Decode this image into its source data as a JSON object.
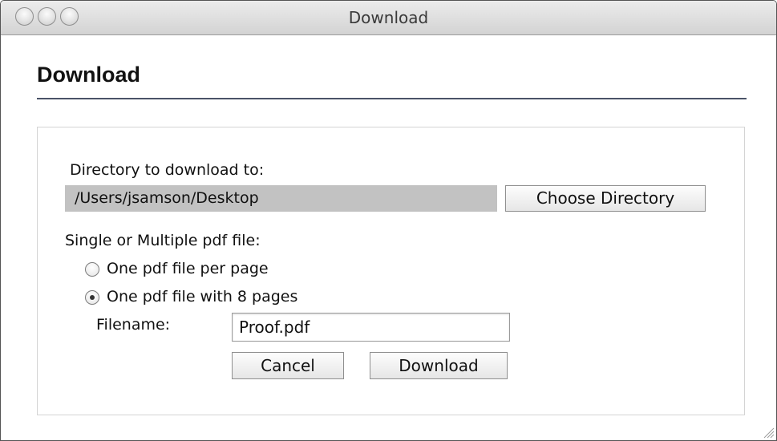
{
  "window": {
    "title": "Download"
  },
  "heading": "Download",
  "directory": {
    "label": "Directory to download to:",
    "path": "/Users/jsamson/Desktop",
    "choose_button": "Choose Directory"
  },
  "mode": {
    "label": "Single or Multiple pdf file:",
    "options": [
      {
        "label": "One pdf file per page",
        "selected": false
      },
      {
        "label": "One pdf file with 8 pages",
        "selected": true
      }
    ]
  },
  "filename": {
    "label": "Filename:",
    "value": "Proof.pdf"
  },
  "actions": {
    "cancel": "Cancel",
    "download": "Download"
  }
}
